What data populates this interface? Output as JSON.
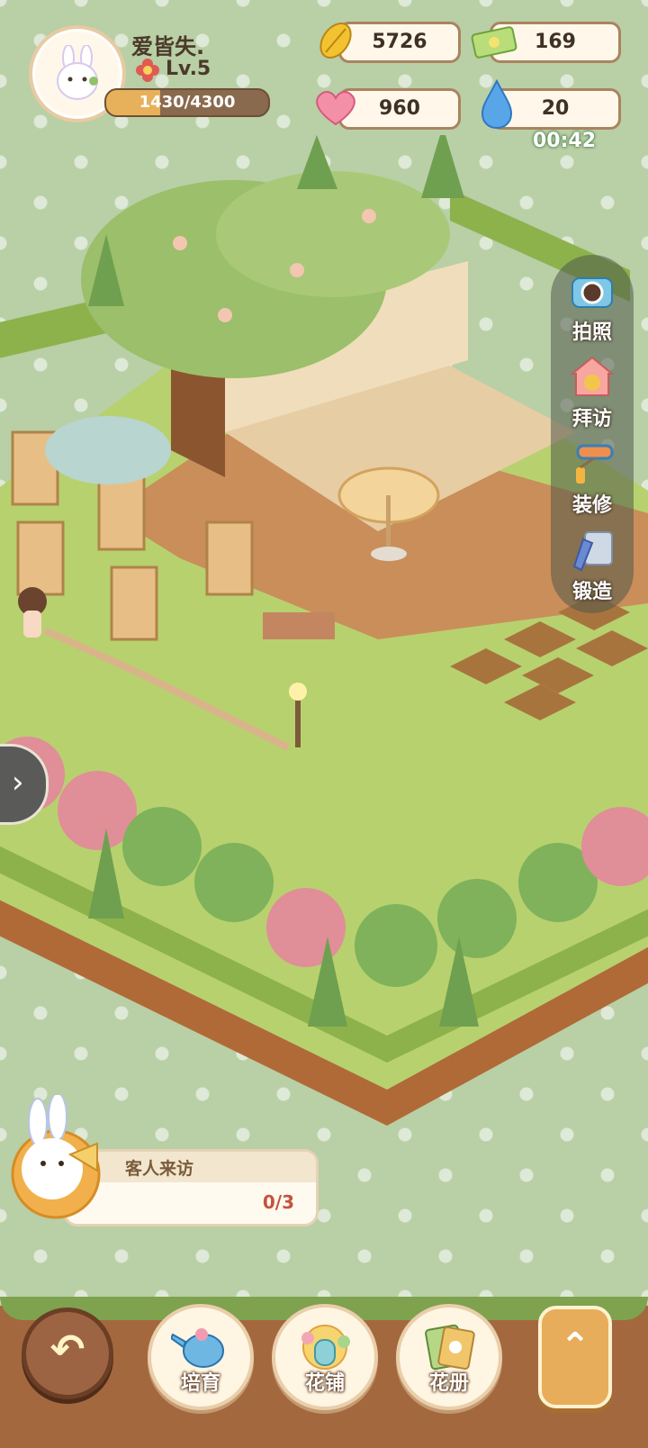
{
  "player": {
    "name": "爱皆失.",
    "level": "Lv.5",
    "xp_text": "1430/4300",
    "xp_fraction": 0.3326
  },
  "resources": {
    "leaf": {
      "value": "5726",
      "icon": "golden-leaf-icon"
    },
    "ticket": {
      "value": "169",
      "icon": "ticket-icon"
    },
    "heart": {
      "value": "960",
      "icon": "heart-icon"
    },
    "water": {
      "value": "20",
      "icon": "water-drop-icon",
      "timer": "00:42"
    }
  },
  "side_menu": [
    {
      "label": "拍照",
      "icon": "camera-icon"
    },
    {
      "label": "拜访",
      "icon": "visit-house-icon"
    },
    {
      "label": "装修",
      "icon": "paint-roller-icon"
    },
    {
      "label": "锻造",
      "icon": "forge-pencil-icon"
    }
  ],
  "task": {
    "title": "客人来访",
    "progress": "0/3",
    "icon": "bunny-megaphone-icon"
  },
  "bottom_bar": {
    "back_icon": "back-arrow-icon",
    "buttons": [
      {
        "label": "培育",
        "icon": "watering-can-icon"
      },
      {
        "label": "花铺",
        "icon": "flower-shop-icon"
      },
      {
        "label": "花册",
        "icon": "flower-album-icon"
      }
    ],
    "expand_icon": "chevron-up-icon"
  },
  "colors": {
    "background": "#b9cfa6",
    "lawn": "#b7d16e",
    "deck": "#c98e5a",
    "ground": "#a4683f",
    "timer": "#ffffff"
  }
}
